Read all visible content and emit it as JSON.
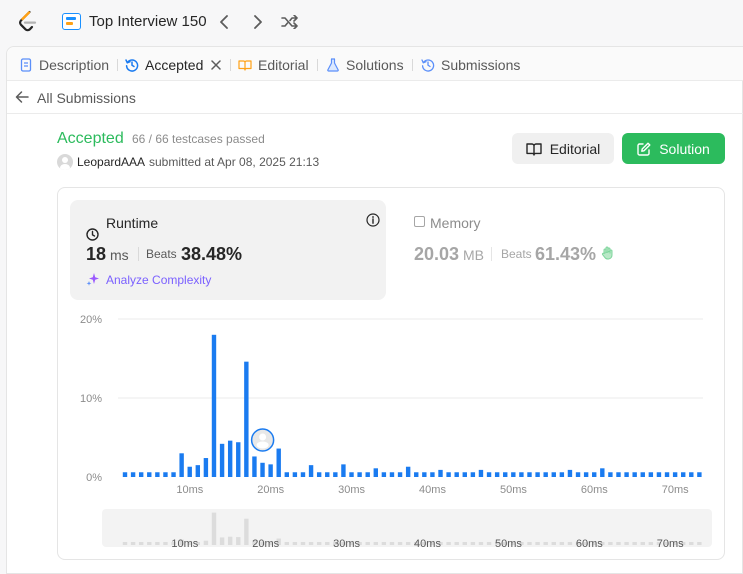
{
  "topbar": {
    "title": "Top Interview 150"
  },
  "tabs": [
    {
      "label": "Description"
    },
    {
      "label": "Accepted"
    },
    {
      "label": "Editorial"
    },
    {
      "label": "Solutions"
    },
    {
      "label": "Submissions"
    }
  ],
  "back": {
    "label": "All Submissions"
  },
  "result": {
    "status": "Accepted",
    "testcases": "66 / 66 testcases passed",
    "username": "LeopardAAA",
    "submitted": "submitted at Apr 08, 2025 21:13"
  },
  "buttons": {
    "editorial": "Editorial",
    "solution": "Solution"
  },
  "runtime": {
    "label": "Runtime",
    "value": "18",
    "unit": "ms",
    "beats_label": "Beats",
    "beats_value": "38.48%",
    "analyze": "Analyze Complexity"
  },
  "memory": {
    "label": "Memory",
    "value": "20.03",
    "unit": "MB",
    "beats_label": "Beats",
    "beats_value": "61.43%"
  },
  "colors": {
    "accepted": "#2cbb5d",
    "bar": "#1a7bf0",
    "analyze": "#7b61ff",
    "muted_bar": "#dcdcdc"
  },
  "chart_data": {
    "type": "bar",
    "xlabel": "",
    "ylabel": "",
    "ylim": [
      0,
      20
    ],
    "y_ticks": [
      "0%",
      "10%",
      "20%"
    ],
    "x_ticks": [
      "10ms",
      "20ms",
      "30ms",
      "40ms",
      "50ms",
      "60ms",
      "70ms"
    ],
    "x_tick_values": [
      10,
      20,
      30,
      40,
      50,
      60,
      70
    ],
    "user_runtime_ms": 18,
    "series": [
      {
        "x": [
          1,
          2,
          3,
          4,
          5,
          6,
          7,
          8,
          9,
          10,
          11,
          12,
          13,
          14,
          15,
          16,
          17,
          18,
          19,
          20,
          21,
          22,
          23,
          24,
          25,
          26,
          27,
          28,
          29,
          30,
          31,
          32,
          33,
          34,
          35,
          36,
          37,
          38,
          39,
          40,
          41,
          42,
          43,
          44,
          45,
          46,
          47,
          48,
          49,
          50,
          51,
          52,
          53,
          54,
          55,
          56,
          57,
          58,
          59,
          60,
          61,
          62,
          63,
          64,
          65,
          66,
          67,
          68,
          69,
          70,
          71,
          72
        ],
        "values": [
          0.6,
          0.6,
          0.6,
          0.6,
          0.6,
          0.6,
          0.6,
          3.0,
          1.3,
          1.5,
          2.4,
          18.0,
          4.2,
          4.6,
          4.4,
          14.6,
          2.6,
          1.8,
          1.6,
          3.6,
          0.6,
          0.6,
          0.6,
          1.5,
          0.6,
          0.6,
          0.6,
          1.6,
          0.6,
          0.6,
          0.6,
          1.1,
          0.6,
          0.6,
          0.6,
          1.3,
          0.6,
          0.6,
          0.6,
          0.9,
          0.6,
          0.6,
          0.6,
          0.6,
          0.9,
          0.6,
          0.6,
          0.6,
          0.6,
          0.6,
          0.6,
          0.6,
          0.6,
          0.6,
          0.6,
          0.9,
          0.6,
          0.6,
          0.6,
          1.1,
          0.6,
          0.6,
          0.6,
          0.6,
          0.6,
          0.6,
          0.6,
          0.6,
          0.6,
          0.6,
          0.6,
          0.6
        ]
      }
    ]
  }
}
